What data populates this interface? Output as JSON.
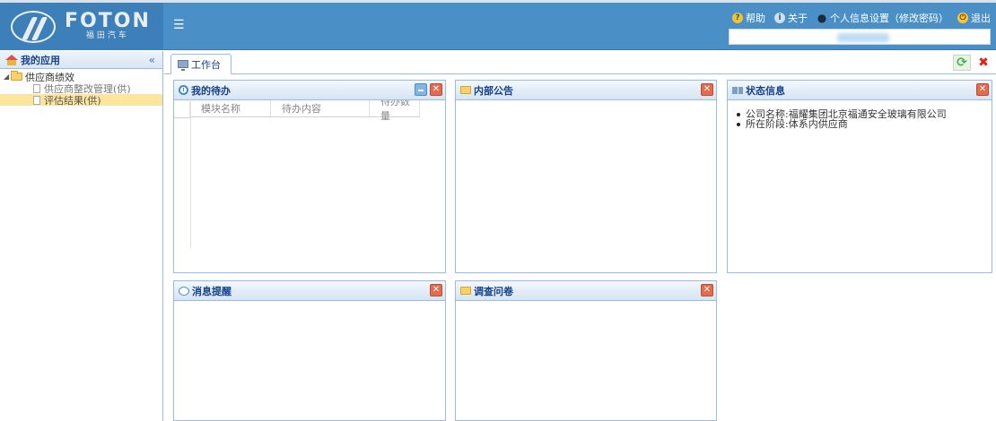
{
  "header": {
    "logo_text": "FOTON",
    "logo_subtitle": "福田汽车",
    "menu_icon": "hamburger-icon",
    "links": [
      {
        "label": "帮助",
        "icon": "help-icon"
      },
      {
        "label": "关于",
        "icon": "about-icon"
      },
      {
        "label": "个人信息设置（修改密码）",
        "icon": "user-icon"
      },
      {
        "label": "退出",
        "icon": "exit-icon"
      }
    ]
  },
  "sidebar": {
    "title": "我的应用",
    "collapse_icon": "collapse-icon",
    "tree": {
      "root": "供应商绩效",
      "children": [
        "供应商整改管理(供)",
        "评估结果(供)"
      ],
      "selected": "评估结果(供)"
    }
  },
  "workspace": {
    "tab_label": "工作台",
    "panels": {
      "todo": {
        "title": "我的待办",
        "columns": [
          "模块名称",
          "待办内容",
          "待办数量"
        ]
      },
      "notice": {
        "title": "内部公告"
      },
      "status": {
        "title": "状态信息",
        "items": [
          "公司名称:福耀集团北京福通安全玻璃有限公司",
          "所在阶段:体系内供应商"
        ]
      },
      "message": {
        "title": "消息提醒"
      },
      "survey": {
        "title": "调查问卷"
      }
    }
  },
  "colors": {
    "header_bg": "#4a90c6",
    "border": "#99bbe8",
    "panel_title": "#15428b",
    "selected_row": "#fce59d"
  }
}
